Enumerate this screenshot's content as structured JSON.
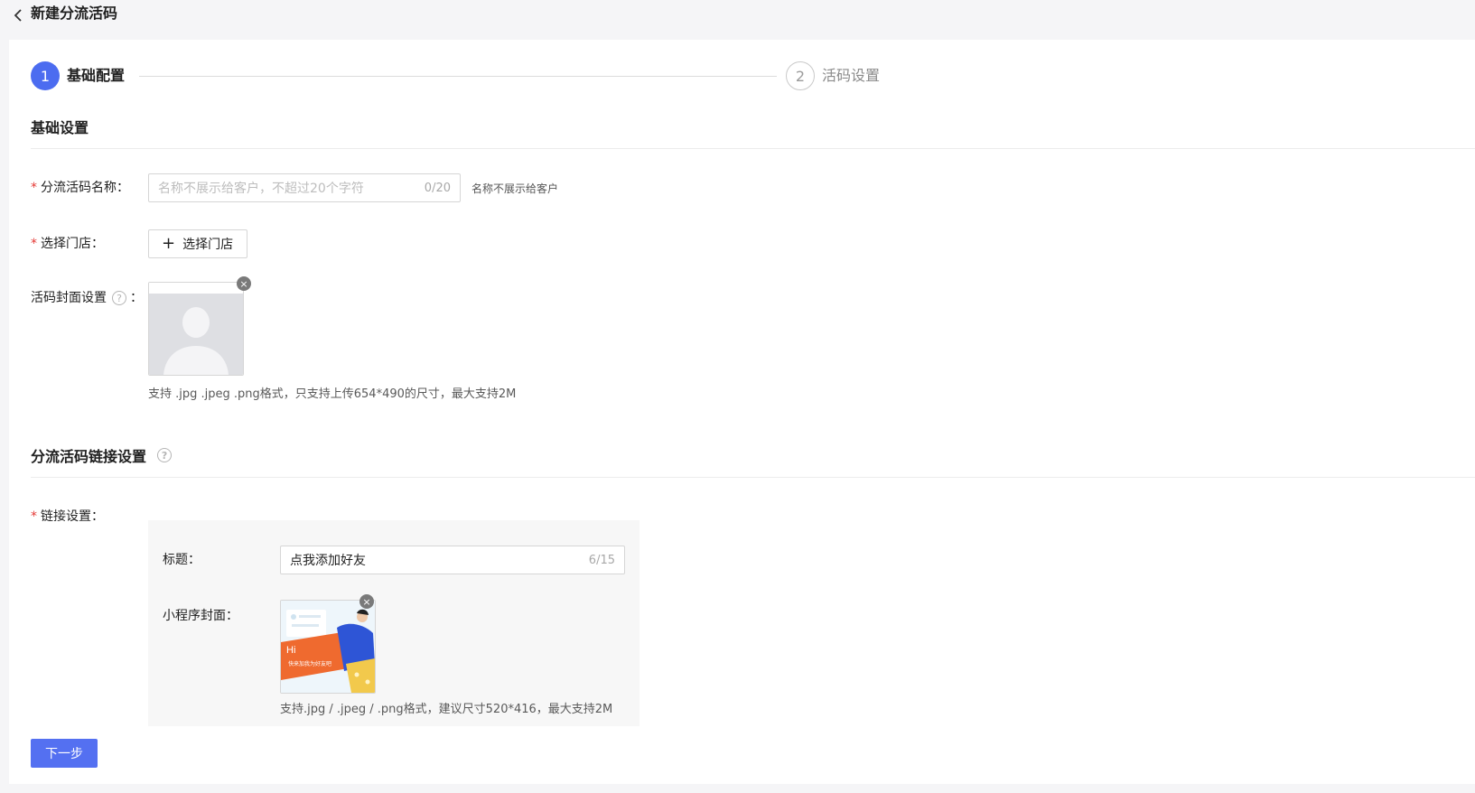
{
  "header": {
    "title": "新建分流活码"
  },
  "steps": [
    {
      "number": "1",
      "label": "基础配置"
    },
    {
      "number": "2",
      "label": "活码设置"
    }
  ],
  "basic_section": {
    "title": "基础设置",
    "name_field": {
      "label": "分流活码名称：",
      "placeholder": "名称不展示给客户，不超过20个字符",
      "counter": "0/20",
      "hint": "名称不展示给客户"
    },
    "store_field": {
      "label": "选择门店：",
      "button": "选择门店"
    },
    "cover_field": {
      "label": "活码封面设置",
      "colon": "：",
      "hint": "支持 .jpg .jpeg .png格式，只支持上传654*490的尺寸，最大支持2M"
    }
  },
  "link_section": {
    "title": "分流活码链接设置",
    "link_field": {
      "label": "链接设置："
    },
    "title_field": {
      "label": "标题：",
      "value": "点我添加好友",
      "counter": "6/15"
    },
    "miniprogram_cover": {
      "label": "小程序封面：",
      "banner_text": "Hi",
      "banner_sub": "快来加我为好友吧",
      "hint": "支持.jpg / .jpeg / .png格式，建议尺寸520*416，最大支持2M"
    }
  },
  "footer": {
    "next_button": "下一步"
  },
  "colors": {
    "primary": "#5470f1",
    "required": "#e53935",
    "banner_orange": "#ef6a2f",
    "figure_blue": "#2e55d6",
    "figure_yellow": "#f2c94c"
  }
}
